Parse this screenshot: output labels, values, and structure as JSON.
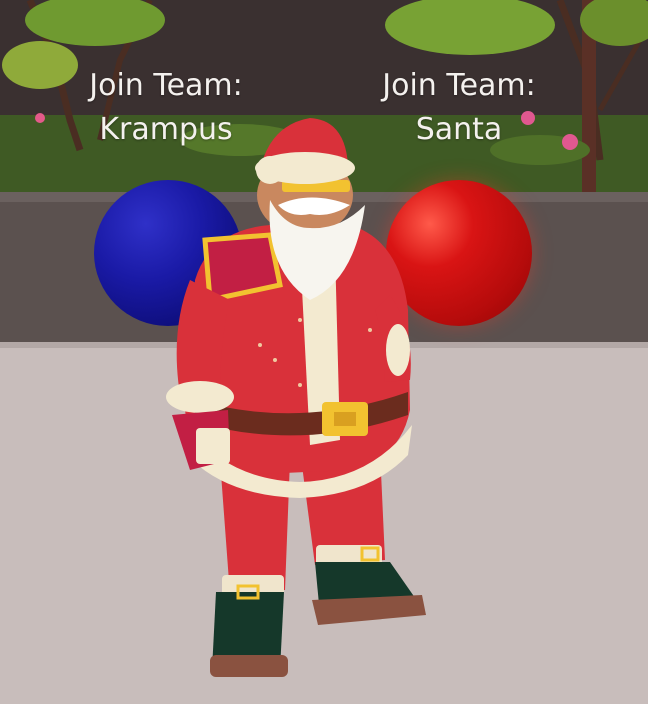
{
  "teams": [
    {
      "id": "krampus",
      "line1": "Join Team:",
      "line2": "Krampus",
      "color": "#1a1aa6"
    },
    {
      "id": "santa",
      "line1": "Join Team:",
      "line2": "Santa",
      "color": "#c80f0f"
    }
  ],
  "colors": {
    "floor": "#c8bdbb",
    "wall": "#5a4f4d",
    "foliage": "#4b6a2a",
    "santa_suit": "#d9313a",
    "fur_trim": "#f3ead0",
    "boots": "#15382a",
    "belt_buckle": "#f2c230"
  },
  "character": {
    "name": "santa-avatar",
    "icon": "santa-icon"
  }
}
